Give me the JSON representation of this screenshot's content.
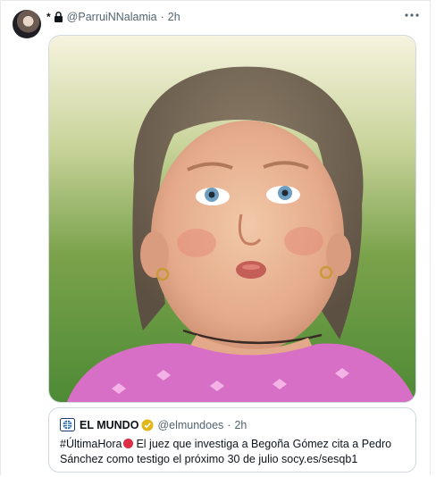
{
  "tweet": {
    "name_prefix": "*",
    "handle": "@ParruiNNalamia",
    "separator": "·",
    "time": "2h",
    "locked": true,
    "avatar": "user-avatar"
  },
  "media": {
    "description_icon": "photo-of-girl-making-face"
  },
  "quote": {
    "source_name": "EL MUNDO",
    "verified_badge": "gold-verified-icon",
    "handle": "@elmundoes",
    "separator": "·",
    "time": "2h",
    "text_before_icon": "#ÚltimaHora",
    "text_after_icon": "El juez que investiga a Begoña Gómez cita a Pedro Sánchez como testigo el próximo 30 de julio socy.es/sesqb1",
    "emoji_icon": "red-circle-icon"
  },
  "colors": {
    "secondary_text": "#536471",
    "border": "#cfd9de",
    "badge_gold": "#e2b719",
    "red_circle": "#dd2e44"
  }
}
